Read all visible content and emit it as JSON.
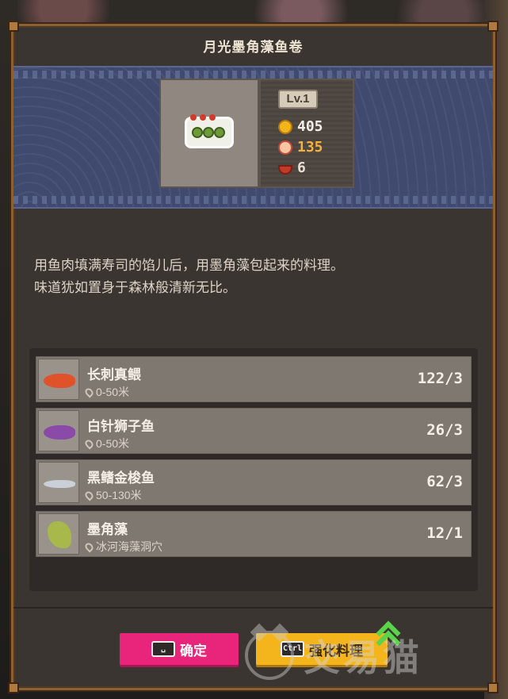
{
  "dish": {
    "title": "月光墨角藻鱼卷",
    "level": "Lv.1",
    "price": "405",
    "taste": "135",
    "servings": "6",
    "description_line1": "用鱼肉填满寿司的馅儿后，用墨角藻包起来的料理。",
    "description_line2": "味道犹如置身于森林般清新无比。"
  },
  "ingredients": [
    {
      "name": "长刺真鳂",
      "location": "0-50米",
      "count": "122/3",
      "icon": "red-fish-icon",
      "color": "#e0522a"
    },
    {
      "name": "白针狮子鱼",
      "location": "0-50米",
      "count": "26/3",
      "icon": "lionfish-icon",
      "color": "#8a4aa8"
    },
    {
      "name": "黑鳍金梭鱼",
      "location": "50-130米",
      "count": "62/3",
      "icon": "barracuda-icon",
      "color": "#c9d0d8"
    },
    {
      "name": "墨角藻",
      "location": "冰河海藻洞穴",
      "count": "12/1",
      "icon": "seaweed-icon",
      "color": "#a8b84a"
    }
  ],
  "buttons": {
    "confirm_key": "␣",
    "confirm_label": "确定",
    "enhance_key": "Ctrl",
    "enhance_label": "强化料理"
  },
  "watermark": {
    "text": "交易猫"
  },
  "colors": {
    "frame": "#8d6034",
    "banner": "#3f4a6e",
    "confirm": "#e8257a",
    "enhance": "#f4b51c"
  }
}
